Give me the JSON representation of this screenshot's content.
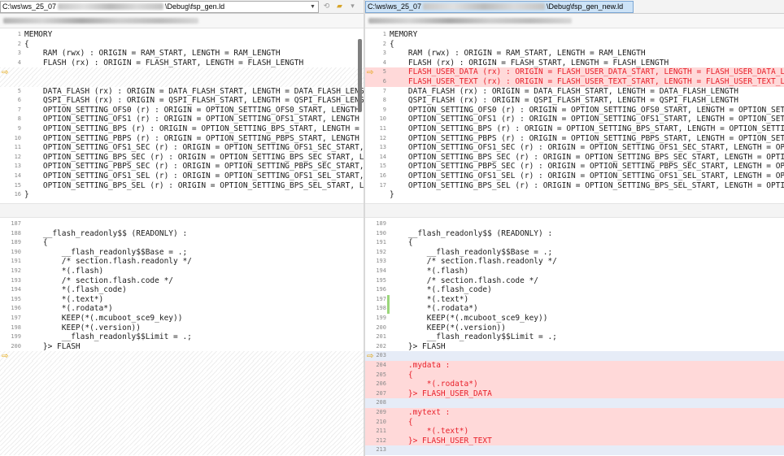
{
  "left": {
    "path_prefix": "C:\\ws\\ws_25_07",
    "path_suffix": "\\Debug\\fsp_gen.ld",
    "top_lines": [
      {
        "n": "1",
        "text": "MEMORY",
        "type": "normal"
      },
      {
        "n": "2",
        "text": "{",
        "type": "normal"
      },
      {
        "n": "3",
        "text": "    RAM (rwx) : ORIGIN = RAM_START, LENGTH = RAM_LENGTH",
        "type": "normal"
      },
      {
        "n": "4",
        "text": "    FLASH (rx) : ORIGIN = FLASH_START, LENGTH = FLASH_LENGTH",
        "type": "normal"
      },
      {
        "n": "",
        "text": "",
        "type": "placeholder"
      },
      {
        "n": "",
        "text": "",
        "type": "placeholder"
      },
      {
        "n": "5",
        "text": "    DATA_FLASH (rx) : ORIGIN = DATA_FLASH_START, LENGTH = DATA_FLASH_LENGTH",
        "type": "normal"
      },
      {
        "n": "6",
        "text": "    QSPI_FLASH (rx) : ORIGIN = QSPI_FLASH_START, LENGTH = QSPI_FLASH_LENGTH",
        "type": "normal"
      },
      {
        "n": "7",
        "text": "    OPTION_SETTING_OFS0 (r) : ORIGIN = OPTION_SETTING_OFS0_START, LENGTH = OPTION_SETTING_OFS0_LENGTH",
        "type": "normal"
      },
      {
        "n": "8",
        "text": "    OPTION_SETTING_OFS1 (r) : ORIGIN = OPTION_SETTING_OFS1_START, LENGTH = OPTION_SETTING_OFS1_LENGTH",
        "type": "normal"
      },
      {
        "n": "9",
        "text": "    OPTION_SETTING_BPS (r) : ORIGIN = OPTION_SETTING_BPS_START, LENGTH = OPTION_SETTING_BPS_LENGTH",
        "type": "normal"
      },
      {
        "n": "10",
        "text": "    OPTION_SETTING_PBPS (r) : ORIGIN = OPTION_SETTING_PBPS_START, LENGTH = OPTION_SETTING_PBPS_LENGTH",
        "type": "normal"
      },
      {
        "n": "11",
        "text": "    OPTION_SETTING_OFS1_SEC (r) : ORIGIN = OPTION_SETTING_OFS1_SEC_START, LENGTH = OPTION_SETTING_OFS1_SEC_LENGTH",
        "type": "normal"
      },
      {
        "n": "12",
        "text": "    OPTION_SETTING_BPS_SEC (r) : ORIGIN = OPTION_SETTING_BPS_SEC_START, LENGTH = OPTION_SETTING_BPS_SEC_LENGTH",
        "type": "normal"
      },
      {
        "n": "13",
        "text": "    OPTION_SETTING_PBPS_SEC (r) : ORIGIN = OPTION_SETTING_PBPS_SEC_START, LENGTH = OPTION_SETTING_PBPS_SEC_LENGTH",
        "type": "normal"
      },
      {
        "n": "14",
        "text": "    OPTION_SETTING_OFS1_SEL (r) : ORIGIN = OPTION_SETTING_OFS1_SEL_START, LENGTH = OPTION_SETTING_OFS1_SEL_LENGTH",
        "type": "normal"
      },
      {
        "n": "15",
        "text": "    OPTION_SETTING_BPS_SEL (r) : ORIGIN = OPTION_SETTING_BPS_SEL_START, LENGTH = OPTION_SETTING_BPS_SEL_LENGTH",
        "type": "normal"
      },
      {
        "n": "16",
        "text": "}",
        "type": "normal"
      }
    ],
    "bottom_lines": [
      {
        "n": "187",
        "text": "",
        "type": "normal"
      },
      {
        "n": "188",
        "text": "    __flash_readonly$$ (READONLY) :",
        "type": "normal"
      },
      {
        "n": "189",
        "text": "    {",
        "type": "normal"
      },
      {
        "n": "190",
        "text": "        __flash_readonly$$Base = .;",
        "type": "normal"
      },
      {
        "n": "191",
        "text": "        /* section.flash.readonly */",
        "type": "normal"
      },
      {
        "n": "192",
        "text": "        *(.flash)",
        "type": "normal"
      },
      {
        "n": "193",
        "text": "        /* section.flash.code */",
        "type": "normal"
      },
      {
        "n": "194",
        "text": "        *(.flash_code)",
        "type": "normal"
      },
      {
        "n": "195",
        "text": "        *(.text*)",
        "type": "normal"
      },
      {
        "n": "196",
        "text": "        *(.rodata*)",
        "type": "normal"
      },
      {
        "n": "197",
        "text": "        KEEP(*(.mcuboot_sce9_key))",
        "type": "normal"
      },
      {
        "n": "198",
        "text": "        KEEP(*(.version))",
        "type": "normal"
      },
      {
        "n": "199",
        "text": "        __flash_readonly$$Limit = .;",
        "type": "normal"
      },
      {
        "n": "200",
        "text": "    }> FLASH",
        "type": "normal"
      },
      {
        "n": "",
        "text": "",
        "type": "placeholder"
      },
      {
        "n": "",
        "text": "",
        "type": "placeholder"
      },
      {
        "n": "",
        "text": "",
        "type": "placeholder"
      },
      {
        "n": "",
        "text": "",
        "type": "placeholder"
      },
      {
        "n": "",
        "text": "",
        "type": "placeholder"
      },
      {
        "n": "",
        "text": "",
        "type": "placeholder"
      },
      {
        "n": "",
        "text": "",
        "type": "placeholder"
      },
      {
        "n": "",
        "text": "",
        "type": "placeholder"
      },
      {
        "n": "",
        "text": "",
        "type": "placeholder"
      },
      {
        "n": "",
        "text": "",
        "type": "placeholder"
      },
      {
        "n": "",
        "text": "",
        "type": "placeholder"
      }
    ]
  },
  "right": {
    "path_prefix": "C:\\ws\\ws_25_07",
    "path_suffix": "\\Debug\\fsp_gen_new.ld",
    "top_lines": [
      {
        "n": "1",
        "text": "MEMORY",
        "type": "normal"
      },
      {
        "n": "2",
        "text": "{",
        "type": "normal"
      },
      {
        "n": "3",
        "text": "    RAM (rwx) : ORIGIN = RAM_START, LENGTH = RAM_LENGTH",
        "type": "normal"
      },
      {
        "n": "4",
        "text": "    FLASH (rx) : ORIGIN = FLASH_START, LENGTH = FLASH_LENGTH",
        "type": "normal"
      },
      {
        "n": "5",
        "text": "    FLASH_USER_DATA (rx) : ORIGIN = FLASH_USER_DATA_START, LENGTH = FLASH_USER_DATA_LENGTH",
        "type": "del"
      },
      {
        "n": "6",
        "text": "    FLASH_USER_TEXT (rx) : ORIGIN = FLASH_USER_TEXT_START, LENGTH = FLASH_USER_TEXT_LENGTH",
        "type": "del"
      },
      {
        "n": "7",
        "text": "    DATA_FLASH (rx) : ORIGIN = DATA_FLASH_START, LENGTH = DATA_FLASH_LENGTH",
        "type": "normal"
      },
      {
        "n": "8",
        "text": "    QSPI_FLASH (rx) : ORIGIN = QSPI_FLASH_START, LENGTH = QSPI_FLASH_LENGTH",
        "type": "normal"
      },
      {
        "n": "9",
        "text": "    OPTION_SETTING_OFS0 (r) : ORIGIN = OPTION_SETTING_OFS0_START, LENGTH = OPTION_SETTING_OFS0_LENGTH",
        "type": "normal"
      },
      {
        "n": "10",
        "text": "    OPTION_SETTING_OFS1 (r) : ORIGIN = OPTION_SETTING_OFS1_START, LENGTH = OPTION_SETTING_OFS1_LENGTH",
        "type": "normal"
      },
      {
        "n": "11",
        "text": "    OPTION_SETTING_BPS (r) : ORIGIN = OPTION_SETTING_BPS_START, LENGTH = OPTION_SETTING_BPS_LENGTH",
        "type": "normal"
      },
      {
        "n": "12",
        "text": "    OPTION_SETTING_PBPS (r) : ORIGIN = OPTION_SETTING_PBPS_START, LENGTH = OPTION_SETTING_PBPS_LENGTH",
        "type": "normal"
      },
      {
        "n": "13",
        "text": "    OPTION_SETTING_OFS1_SEC (r) : ORIGIN = OPTION_SETTING_OFS1_SEC_START, LENGTH = OPTION_SETTING_OFS1_SEC_LENGTH",
        "type": "normal"
      },
      {
        "n": "14",
        "text": "    OPTION_SETTING_BPS_SEC (r) : ORIGIN = OPTION_SETTING_BPS_SEC_START, LENGTH = OPTION_SETTING_BPS_SEC_LENGTH",
        "type": "normal"
      },
      {
        "n": "15",
        "text": "    OPTION_SETTING_PBPS_SEC (r) : ORIGIN = OPTION_SETTING_PBPS_SEC_START, LENGTH = OPTION_SETTING_PBPS_SEC_LENGTH",
        "type": "normal"
      },
      {
        "n": "16",
        "text": "    OPTION_SETTING_OFS1_SEL (r) : ORIGIN = OPTION_SETTING_OFS1_SEL_START, LENGTH = OPTION_SETTING_OFS1_SEL_LENGTH",
        "type": "normal"
      },
      {
        "n": "17",
        "text": "    OPTION_SETTING_BPS_SEL (r) : ORIGIN = OPTION_SETTING_BPS_SEL_START, LENGTH = OPTION_SETTING_BPS_SEL_LENGTH",
        "type": "normal"
      },
      {
        "n": "",
        "text": "}",
        "type": "normal"
      }
    ],
    "bottom_lines": [
      {
        "n": "189",
        "text": "",
        "type": "normal"
      },
      {
        "n": "190",
        "text": "    __flash_readonly$$ (READONLY) :",
        "type": "normal"
      },
      {
        "n": "191",
        "text": "    {",
        "type": "normal"
      },
      {
        "n": "192",
        "text": "        __flash_readonly$$Base = .;",
        "type": "normal"
      },
      {
        "n": "193",
        "text": "        /* section.flash.readonly */",
        "type": "normal"
      },
      {
        "n": "194",
        "text": "        *(.flash)",
        "type": "normal"
      },
      {
        "n": "195",
        "text": "        /* section.flash.code */",
        "type": "normal"
      },
      {
        "n": "196",
        "text": "        *(.flash_code)",
        "type": "normal"
      },
      {
        "n": "197",
        "text": "        *(.text*)",
        "type": "chg"
      },
      {
        "n": "198",
        "text": "        *(.rodata*)",
        "type": "chg"
      },
      {
        "n": "199",
        "text": "        KEEP(*(.mcuboot_sce9_key))",
        "type": "normal"
      },
      {
        "n": "200",
        "text": "        KEEP(*(.version))",
        "type": "normal"
      },
      {
        "n": "201",
        "text": "        __flash_readonly$$Limit = .;",
        "type": "normal"
      },
      {
        "n": "202",
        "text": "    }> FLASH",
        "type": "normal"
      },
      {
        "n": "203",
        "text": "",
        "type": "sep"
      },
      {
        "n": "204",
        "text": "    .mydata :",
        "type": "del"
      },
      {
        "n": "205",
        "text": "    {",
        "type": "del"
      },
      {
        "n": "206",
        "text": "        *(.rodata*)",
        "type": "del"
      },
      {
        "n": "207",
        "text": "    }> FLASH_USER_DATA",
        "type": "del"
      },
      {
        "n": "208",
        "text": "",
        "type": "sep"
      },
      {
        "n": "209",
        "text": "    .mytext :",
        "type": "del"
      },
      {
        "n": "210",
        "text": "    {",
        "type": "del"
      },
      {
        "n": "211",
        "text": "        *(.text*)",
        "type": "del"
      },
      {
        "n": "212",
        "text": "    }> FLASH_USER_TEXT",
        "type": "del"
      },
      {
        "n": "213",
        "text": "",
        "type": "sep"
      }
    ]
  },
  "markers": {
    "arrow_icon": "arrow-right-icon",
    "arrow_color": "#e0a000"
  },
  "colors": {
    "deleted_bg": "#ffd9d9",
    "deleted_text": "#e8202a",
    "changed_marker": "#9bd67a",
    "separator_bg": "#e6ecf7"
  }
}
